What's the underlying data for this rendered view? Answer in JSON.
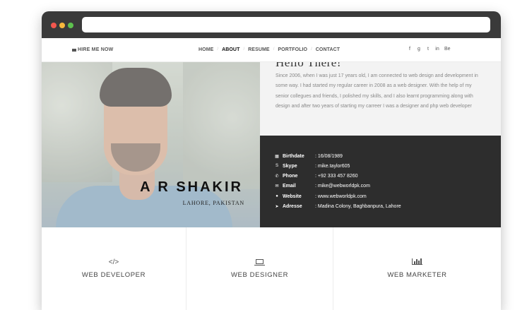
{
  "browser": {
    "address": ""
  },
  "nav": {
    "hire": "HIRE ME NOW",
    "items": [
      "HOME",
      "ABOUT",
      "RESUME",
      "PORTFOLIO",
      "CONTACT"
    ],
    "active": "ABOUT",
    "social": [
      "f",
      "g",
      "t",
      "in",
      "Be"
    ],
    "social_icons": [
      "facebook-icon",
      "google-plus-icon",
      "twitter-icon",
      "linkedin-icon",
      "behance-icon"
    ]
  },
  "profile": {
    "name": "A R SHAKIR",
    "location": "LAHORE, PAKISTAN"
  },
  "about": {
    "greeting": "Hello There!",
    "bio": "Since 2006, when I was just 17 years old, I am connected to web design and development in some way. I had started my regular career in 2008 as a web designer. With the help of my senior collegues and friends, I polished my skills, and I also learnt programming along with design and after two years of starting my carreer I was a designer and php web developer",
    "info": [
      {
        "icon": "calendar-icon",
        "label": "Birthdate",
        "value": ": 16/08/1989"
      },
      {
        "icon": "skype-icon",
        "label": "Skype",
        "value": ": mike.taylor605"
      },
      {
        "icon": "phone-icon",
        "label": "Phone",
        "value": ": +92 333 457 8260"
      },
      {
        "icon": "envelope-icon",
        "label": "Email",
        "value": ": mike@webworldpk.com"
      },
      {
        "icon": "globe-icon",
        "label": "Website",
        "value": ": www.webworldpk.com"
      },
      {
        "icon": "location-arrow-icon",
        "label": "Adresse",
        "value": ": Madina Colony, Baghbanpura, Lahore"
      }
    ]
  },
  "services": [
    {
      "icon": "code-icon",
      "label": "WEB DEVELOPER"
    },
    {
      "icon": "laptop-icon",
      "label": "WEB DESIGNER"
    },
    {
      "icon": "bar-chart-icon",
      "label": "WEB MARKETER"
    }
  ]
}
